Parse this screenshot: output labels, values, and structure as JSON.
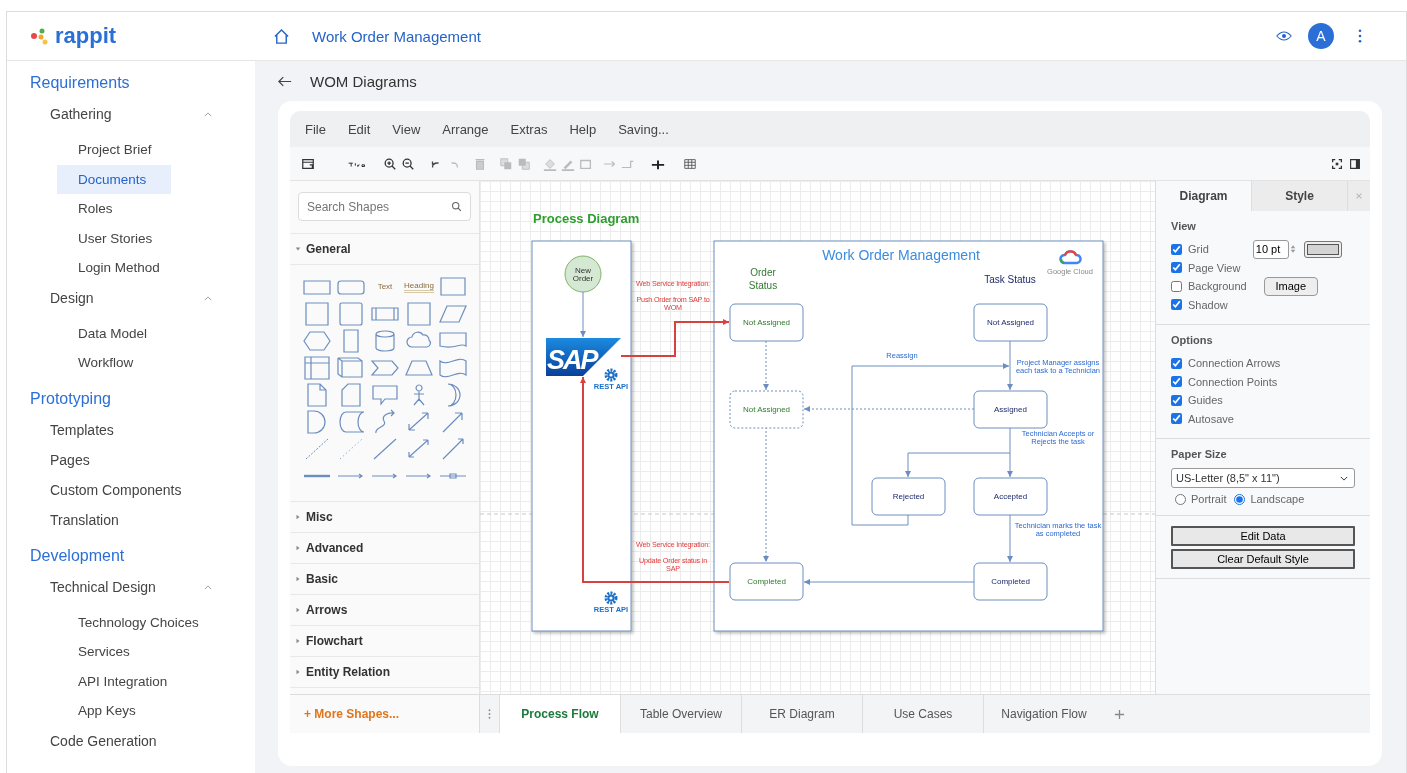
{
  "logo": "rappit",
  "header": {
    "title": "Work Order Management",
    "avatar": "A"
  },
  "sidebar": {
    "sections": [
      {
        "label": "Requirements",
        "items": [
          {
            "label": "Gathering",
            "selected": false,
            "expanded": true,
            "children": [
              {
                "label": "Project Brief",
                "selected": false
              },
              {
                "label": "Documents",
                "selected": true
              },
              {
                "label": "Roles",
                "selected": false
              },
              {
                "label": "User Stories",
                "selected": false
              },
              {
                "label": "Login Method",
                "selected": false
              }
            ]
          },
          {
            "label": "Design",
            "selected": false,
            "expanded": true,
            "children": [
              {
                "label": "Data Model",
                "selected": false
              },
              {
                "label": "Workflow",
                "selected": false
              }
            ]
          }
        ]
      },
      {
        "label": "Prototyping",
        "items": [
          {
            "label": "Templates",
            "selected": false
          },
          {
            "label": "Pages",
            "selected": false
          },
          {
            "label": "Custom Components",
            "selected": false
          },
          {
            "label": "Translation",
            "selected": false
          }
        ]
      },
      {
        "label": "Development",
        "items": [
          {
            "label": "Technical Design",
            "selected": false,
            "expanded": true,
            "children": [
              {
                "label": "Technology Choices",
                "selected": false
              },
              {
                "label": "Services",
                "selected": false
              },
              {
                "label": "API Integration",
                "selected": false
              },
              {
                "label": "App Keys",
                "selected": false
              }
            ]
          },
          {
            "label": "Code Generation",
            "selected": false
          }
        ]
      }
    ]
  },
  "breadcrumb": "WOM Diagrams",
  "editor": {
    "menu": [
      "File",
      "Edit",
      "View",
      "Arrange",
      "Extras",
      "Help"
    ],
    "status": "Saving...",
    "shapes_panel": {
      "search": {
        "placeholder": "Search Shapes"
      },
      "text_shape": "Text",
      "heading_shape": "Heading",
      "categories": [
        {
          "label": "General",
          "expanded": true
        },
        {
          "label": "Misc",
          "expanded": false
        },
        {
          "label": "Advanced",
          "expanded": false
        },
        {
          "label": "Basic",
          "expanded": false
        },
        {
          "label": "Arrows",
          "expanded": false
        },
        {
          "label": "Flowchart",
          "expanded": false
        },
        {
          "label": "Entity Relation",
          "expanded": false
        }
      ],
      "more_shapes": "+ More Shapes..."
    },
    "diagram": {
      "title": "Process Diagram",
      "container_title": "Work Order Management",
      "cloud_caption": "Google Cloud",
      "sap_logo": "SAP",
      "api_labels": [
        "REST API",
        "REST API"
      ],
      "order_status": [
        "Order",
        "Status"
      ],
      "task_status": "Task Status",
      "start_node": [
        "New",
        "Order"
      ],
      "order_nodes": [
        {
          "label": "Not Assigned",
          "kind": "solid"
        },
        {
          "label": "Not Assigned",
          "kind": "dashed"
        },
        {
          "label": "Completed",
          "kind": "solid"
        }
      ],
      "task_nodes": [
        {
          "label": "Not Assigned",
          "kind": "solid"
        },
        {
          "label": "Assigned",
          "kind": "solid"
        },
        {
          "label": "Rejected",
          "kind": "solid"
        },
        {
          "label": "Accepted",
          "kind": "solid"
        },
        {
          "label": "Completed",
          "kind": "solid"
        }
      ],
      "integration_notes": [
        {
          "heading": "Web Service Integration:",
          "lines": [
            "Push Order from SAP to",
            "WOM"
          ]
        },
        {
          "heading": "Web Service Integration:",
          "lines": [
            "Update Order status in",
            "SAP"
          ]
        }
      ],
      "edge_labels": [
        [
          "Reassign"
        ],
        [
          "Project Manager assigns",
          "each task to a Technician"
        ],
        [
          "Technician Accepts or",
          "Rejects the task"
        ],
        [
          "Technician marks the task",
          "as completed"
        ]
      ]
    },
    "format_panel": {
      "tabs": [
        {
          "label": "Diagram",
          "selected": true
        },
        {
          "label": "Style",
          "selected": false
        }
      ],
      "view": {
        "title": "View",
        "options": [
          {
            "label": "Grid",
            "checked": true
          },
          {
            "label": "Page View",
            "checked": true
          },
          {
            "label": "Background",
            "checked": false
          },
          {
            "label": "Shadow",
            "checked": true
          }
        ],
        "grid_size": "10 pt",
        "image_button": "Image"
      },
      "options": {
        "title": "Options",
        "items": [
          {
            "label": "Connection Arrows",
            "checked": true
          },
          {
            "label": "Connection Points",
            "checked": true
          },
          {
            "label": "Guides",
            "checked": true
          },
          {
            "label": "Autosave",
            "checked": true
          }
        ]
      },
      "paper": {
        "title": "Paper Size",
        "value": "US-Letter (8,5\" x 11\")",
        "orientations": [
          {
            "label": "Portrait",
            "selected": false
          },
          {
            "label": "Landscape",
            "selected": true
          }
        ]
      },
      "buttons": [
        "Edit Data",
        "Clear Default Style"
      ]
    },
    "pages": [
      {
        "label": "Process Flow",
        "selected": true
      },
      {
        "label": "Table Overview",
        "selected": false
      },
      {
        "label": "ER Diagram",
        "selected": false
      },
      {
        "label": "Use Cases",
        "selected": false
      },
      {
        "label": "Navigation Flow",
        "selected": false
      }
    ]
  }
}
